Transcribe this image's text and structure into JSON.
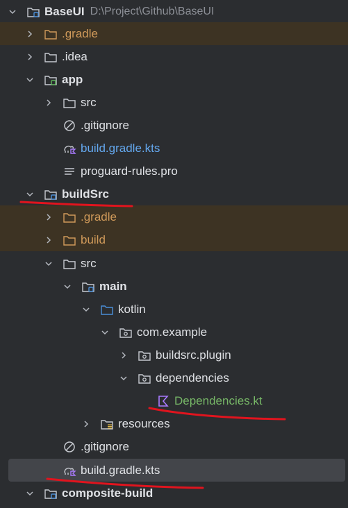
{
  "tree": {
    "root": {
      "label": "BaseUI",
      "path": "D:\\Project\\Github\\BaseUI",
      "icon": "module-folder-icon"
    },
    "items": [
      {
        "label": ".gradle",
        "icon": "folder-icon",
        "color": "#d09a5a"
      },
      {
        "label": ".idea",
        "icon": "folder-icon"
      },
      {
        "label": "app",
        "icon": "module-folder-icon"
      },
      {
        "label": "src",
        "icon": "folder-icon"
      },
      {
        "label": ".gitignore",
        "icon": "gitignore-icon"
      },
      {
        "label": "build.gradle.kts",
        "icon": "gradle-kts-icon",
        "color": "#64a8ef"
      },
      {
        "label": "proguard-rules.pro",
        "icon": "text-file-icon"
      },
      {
        "label": "buildSrc",
        "icon": "module-folder-icon"
      },
      {
        "label": ".gradle",
        "icon": "folder-icon",
        "color": "#d09a5a"
      },
      {
        "label": "build",
        "icon": "folder-icon",
        "color": "#d09a5a"
      },
      {
        "label": "src",
        "icon": "folder-icon"
      },
      {
        "label": "main",
        "icon": "source-root-folder-icon"
      },
      {
        "label": "kotlin",
        "icon": "blue-folder-icon"
      },
      {
        "label": "com.example",
        "icon": "package-icon"
      },
      {
        "label": "buildsrc.plugin",
        "icon": "package-icon"
      },
      {
        "label": "dependencies",
        "icon": "package-icon"
      },
      {
        "label": "Dependencies.kt",
        "icon": "kotlin-file-icon",
        "color": "#77b767"
      },
      {
        "label": "resources",
        "icon": "resources-folder-icon"
      },
      {
        "label": ".gitignore",
        "icon": "gitignore-icon"
      },
      {
        "label": "build.gradle.kts",
        "icon": "gradle-kts-icon"
      },
      {
        "label": "composite-build",
        "icon": "module-folder-icon"
      }
    ]
  },
  "colors": {
    "background": "#2b2d30",
    "excluded_row": "#3d3323",
    "selected_row": "#43454a",
    "annotation_red": "#e0141e"
  }
}
